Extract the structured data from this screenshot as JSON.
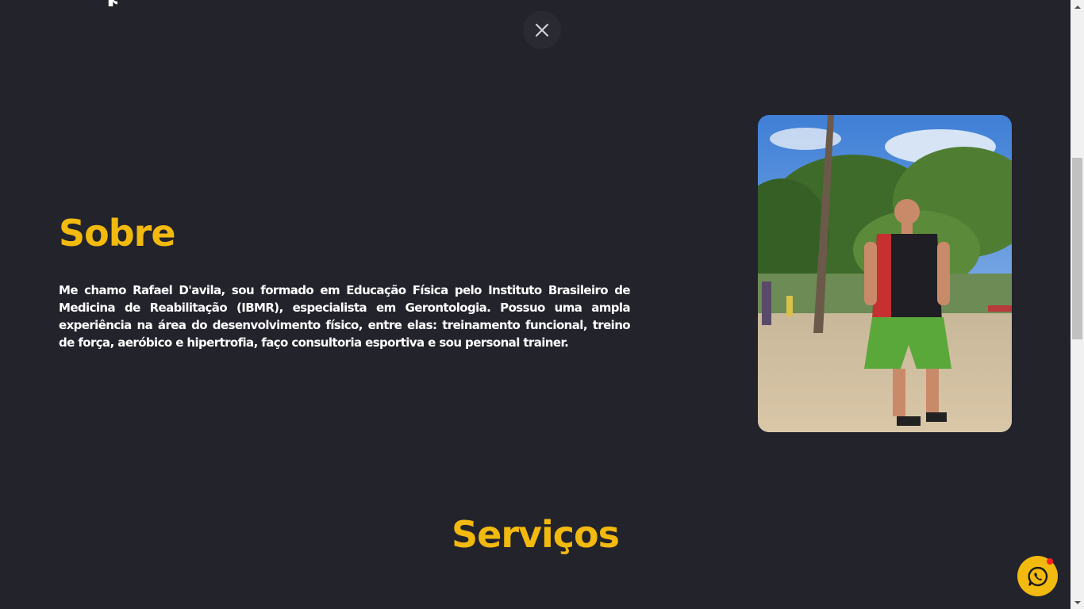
{
  "close_button": {
    "icon": "close-icon"
  },
  "about": {
    "title": "Sobre",
    "text": "Me chamo Rafael D'avila, sou formado em Educação Física pelo Instituto Brasileiro de Medicina de Reabilitação (IBMR), especialista em Gerontologia. Possuo uma ampla experiência na área do desenvolvimento físico, entre elas: treinamento funcional, treino de força, aeróbico e hipertrofia, faço consultoria esportiva e sou personal trainer."
  },
  "services": {
    "title": "Serviços"
  },
  "whatsapp_button": {
    "icon": "whatsapp-icon",
    "has_notification": true
  },
  "colors": {
    "background": "#23232c",
    "accent": "#f2b90f",
    "text": "#ffffff",
    "notification": "#ff1f1f"
  }
}
